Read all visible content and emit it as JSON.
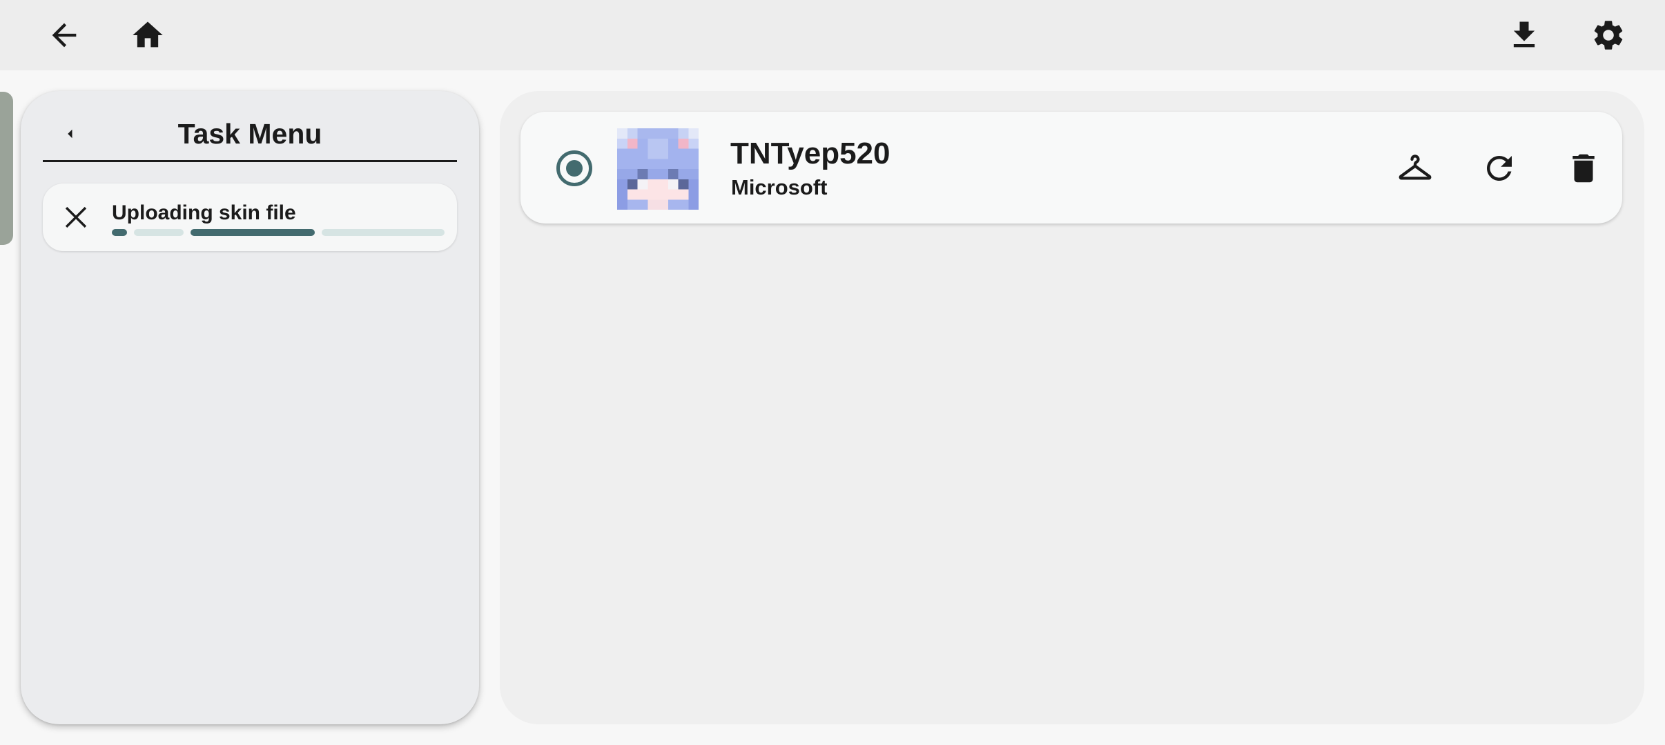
{
  "topbar": {
    "back_icon": "arrow-left-icon",
    "home_icon": "home-icon",
    "download_icon": "download-icon",
    "settings_icon": "gear-icon"
  },
  "task_menu": {
    "title": "Task Menu",
    "back_icon": "caret-left-icon",
    "tasks": [
      {
        "label": "Uploading skin file",
        "cancel_icon": "close-icon",
        "progress_style": "indeterminate"
      }
    ]
  },
  "accounts": [
    {
      "name": "TNTyep520",
      "type": "Microsoft",
      "selected": true,
      "actions": [
        "hanger-icon",
        "refresh-icon",
        "trash-icon"
      ]
    }
  ],
  "colors": {
    "accent": "#436b6f",
    "accent_light": "#d6e4e3",
    "topbar_bg": "#ededed",
    "panel_bg": "#ebecee",
    "main_bg": "#efefef",
    "edge_handle": "#9aa399"
  }
}
